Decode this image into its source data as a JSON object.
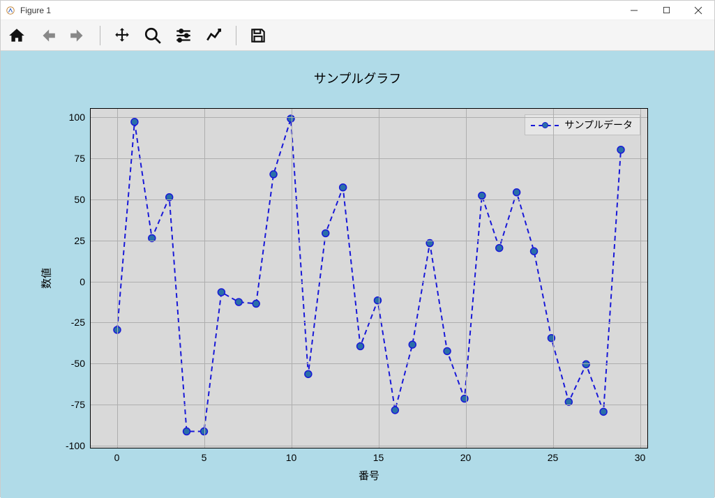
{
  "window": {
    "title": "Figure 1"
  },
  "toolbar": {
    "home": "home-icon",
    "back": "arrow-left-icon",
    "forward": "arrow-right-icon",
    "pan": "move-icon",
    "zoom": "zoom-icon",
    "subplots": "sliders-icon",
    "axes": "chart-line-icon",
    "save": "save-icon"
  },
  "chart_data": {
    "type": "line",
    "title": "サンプルグラフ",
    "xlabel": "番号",
    "ylabel": "数値",
    "xlim": [
      -1.5,
      30.5
    ],
    "ylim": [
      -102,
      105
    ],
    "xticks": [
      0,
      5,
      10,
      15,
      20,
      25,
      30
    ],
    "yticks": [
      -100,
      -75,
      -50,
      -25,
      0,
      25,
      50,
      75,
      100
    ],
    "legend": {
      "position": "upper right"
    },
    "series": [
      {
        "name": "サンプルデータ",
        "style": "dashed-markers",
        "color": "#1818d8",
        "marker_fill": "#2a6fa8",
        "x": [
          0,
          1,
          2,
          3,
          4,
          5,
          6,
          7,
          8,
          9,
          10,
          11,
          12,
          13,
          14,
          15,
          16,
          17,
          18,
          19,
          20,
          21,
          22,
          23,
          24,
          25,
          26,
          27,
          28,
          29
        ],
        "y": [
          -30,
          97,
          26,
          51,
          -92,
          -92,
          -7,
          -13,
          -14,
          65,
          99,
          -57,
          29,
          57,
          -40,
          -12,
          -79,
          -39,
          23,
          -43,
          -72,
          52,
          20,
          54,
          18,
          -35,
          -74,
          -51,
          -80,
          80
        ]
      }
    ]
  }
}
